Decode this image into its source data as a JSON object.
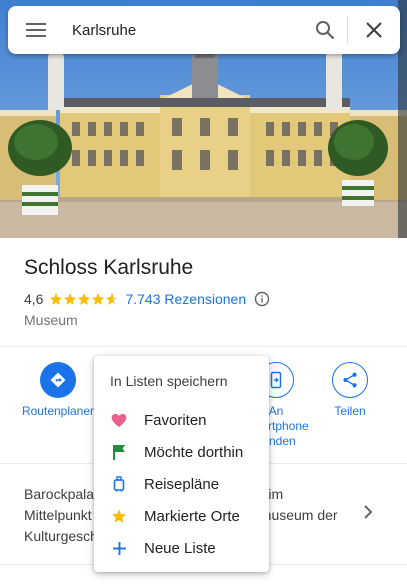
{
  "search": {
    "query": "Karlsruhe"
  },
  "place": {
    "title": "Schloss Karlsruhe",
    "rating": "4,6",
    "stars": 4.6,
    "reviews": "7.743 Rezensionen",
    "category": "Museum"
  },
  "actions": [
    {
      "label": "Routenplaner",
      "icon": "directions-icon"
    },
    {
      "label": "An\nSmartphone\nsenden",
      "icon": "send-to-phone-icon"
    },
    {
      "label": "Teilen",
      "icon": "share-icon"
    }
  ],
  "description": {
    "text": "Barockpalast aus dem 18. Jahrhundert im Mittelpunkt der Stadt, mit dem Landesmuseum der Kulturgeschichte"
  },
  "save_menu": {
    "title": "In Listen speichern",
    "items": [
      {
        "label": "Favoriten",
        "icon": "heart-icon",
        "color": "#ee5f8f"
      },
      {
        "label": "Möchte dorthin",
        "icon": "flag-icon",
        "color": "#1e8e3e"
      },
      {
        "label": "Reisepläne",
        "icon": "suitcase-icon",
        "color": "#1a73e8"
      },
      {
        "label": "Markierte Orte",
        "icon": "star-icon",
        "color": "#fbbc04"
      },
      {
        "label": "Neue Liste",
        "icon": "plus-icon",
        "color": "#1a73e8"
      }
    ]
  },
  "colors": {
    "accent": "#1a73e8",
    "star": "#fbbc04"
  }
}
